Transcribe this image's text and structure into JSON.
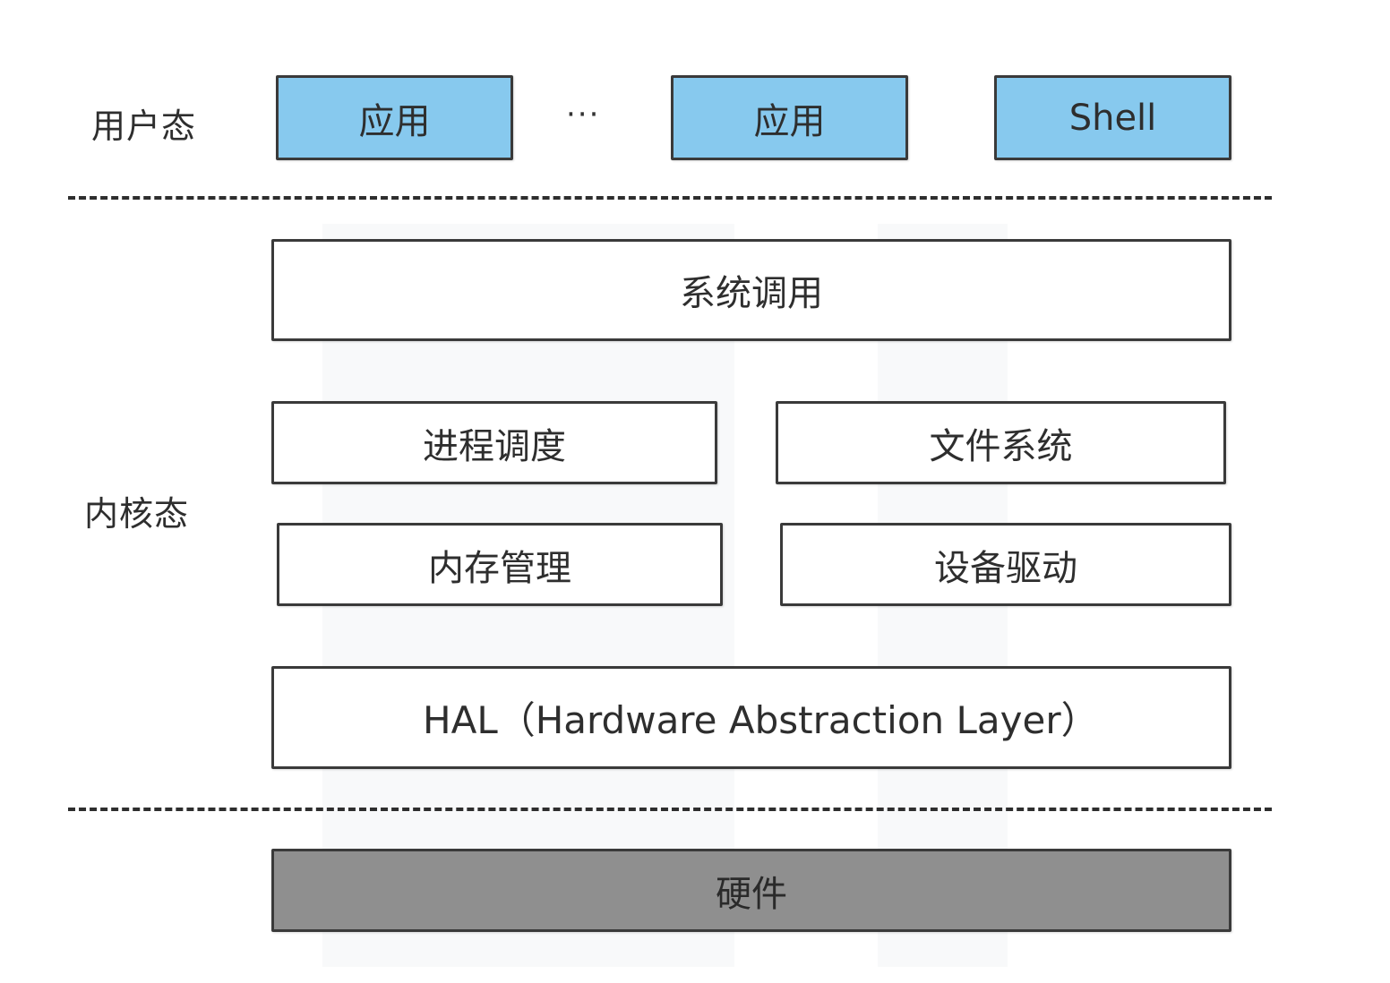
{
  "user_space": {
    "label": "用户态",
    "apps": [
      "应用",
      "应用",
      "Shell"
    ],
    "ellipsis": "···"
  },
  "kernel_space": {
    "label": "内核态",
    "syscall": "系统调用",
    "modules": {
      "process_scheduling": "进程调度",
      "file_system": "文件系统",
      "memory_management": "内存管理",
      "device_driver": "设备驱动"
    },
    "hal": "HAL（Hardware Abstraction Layer）"
  },
  "hardware": {
    "label": "硬件"
  },
  "colors": {
    "user_box_fill": "#87c9ee",
    "hardware_box_fill": "#8f8f8f",
    "border": "#3a3a3a"
  }
}
